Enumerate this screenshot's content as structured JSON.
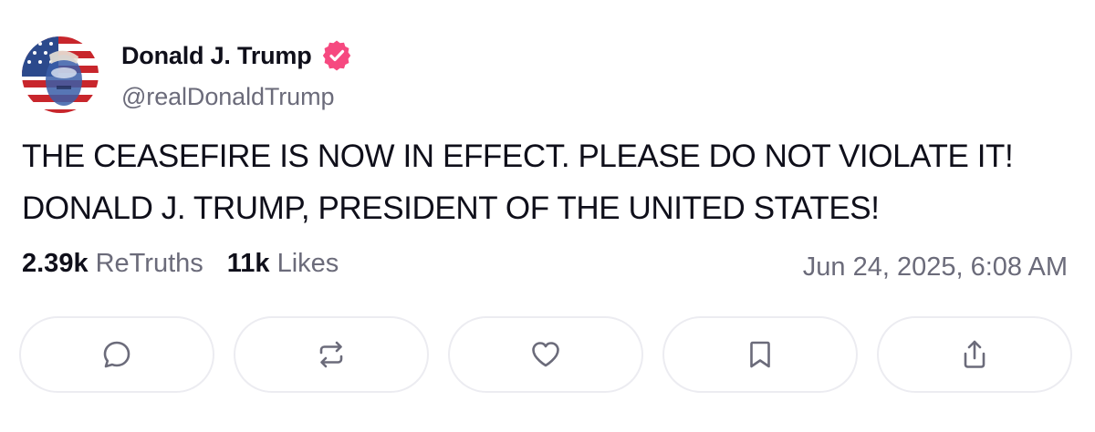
{
  "author": {
    "display_name": "Donald J. Trump",
    "handle": "@realDonaldTrump",
    "verified_color": "#f64980",
    "avatar_icon": "avatar-flag-portrait"
  },
  "post": {
    "lines": [
      "THE CEASEFIRE IS NOW IN EFFECT. PLEASE DO NOT VIOLATE IT!",
      "DONALD J. TRUMP, PRESIDENT OF THE UNITED STATES!"
    ]
  },
  "stats": {
    "retruths_count": "2.39k",
    "retruths_label": "ReTruths",
    "likes_count": "11k",
    "likes_label": "Likes"
  },
  "timestamp": "Jun 24, 2025, 6:08 AM",
  "actions": [
    {
      "name": "reply",
      "icon": "comment-icon"
    },
    {
      "name": "retruth",
      "icon": "repost-icon"
    },
    {
      "name": "like",
      "icon": "heart-icon"
    },
    {
      "name": "bookmark",
      "icon": "bookmark-icon"
    },
    {
      "name": "share",
      "icon": "share-icon"
    }
  ],
  "colors": {
    "text": "#0f0f1a",
    "muted": "#6b6b7a",
    "button_border": "#ececf1",
    "icon": "#6b6b7a"
  }
}
